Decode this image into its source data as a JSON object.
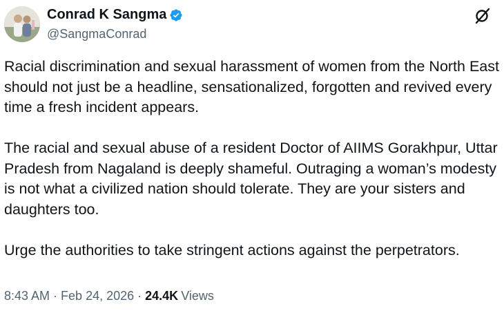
{
  "author": {
    "display_name": "Conrad K Sangma",
    "handle": "@SangmaConrad",
    "verified": true,
    "verified_color": "#1d9bf0",
    "avatar_icon": "profile-photo"
  },
  "tweet": {
    "paragraphs": [
      "Racial discrimination and sexual harassment  of women from the North East should not just be a headline, sensationalized, forgotten and revived every time a fresh incident appears.",
      "The racial and sexual abuse of a resident Doctor of AIIMS Gorakhpur, Uttar Pradesh from Nagaland is deeply shameful. Outraging a woman’s modesty is not what a civilized nation should tolerate. They are your sisters and daughters too.",
      "Urge the authorities to take stringent actions against the perpetrators."
    ]
  },
  "meta": {
    "time": "8:43 AM",
    "separator": "·",
    "date": "Feb 24, 2026",
    "views_count": "24.4K",
    "views_label": "Views"
  },
  "icons": {
    "grok": "grok-icon"
  }
}
